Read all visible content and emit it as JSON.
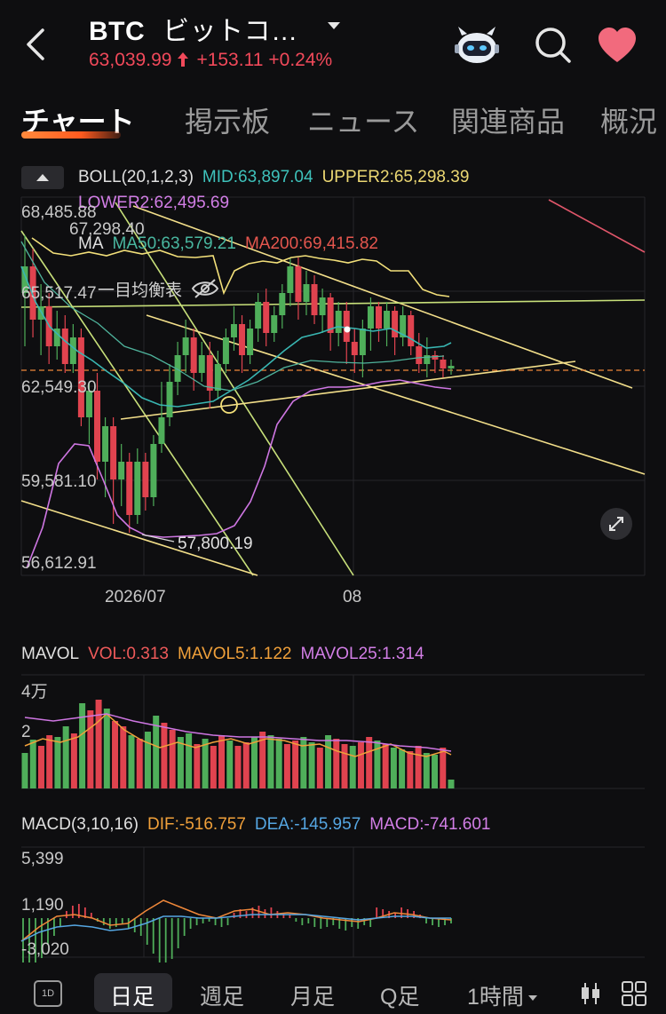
{
  "header": {
    "symbol": "BTC",
    "name": "ビットコ…",
    "price": "63,039.99",
    "change": "+153.11",
    "change_pct": "+0.24%",
    "up_color": "#f1495a",
    "icons": [
      "back-icon",
      "chevron-down-icon",
      "robot-icon",
      "search-icon",
      "heart-icon"
    ]
  },
  "tabs": [
    {
      "label": "チャート",
      "active": true
    },
    {
      "label": "掲示板"
    },
    {
      "label": "ニュース"
    },
    {
      "label": "関連商品"
    },
    {
      "label": "概況"
    }
  ],
  "main_chart": {
    "boll": {
      "label": "BOLL(20,1,2,3)",
      "mid": "MID:63,897.04",
      "upper2": "UPPER2:65,298.39",
      "lower2": "LOWER2:62,495.69"
    },
    "ma": {
      "label": "MA",
      "ma50": "MA50:63,579.21",
      "ma200": "MA200:69,415.82"
    },
    "ichimoku_label": "一目均衡表",
    "y_labels": [
      "68,485.88",
      "67,298.40",
      "65,517.47",
      "62,549.30",
      "59,581.10",
      "56,612.91"
    ],
    "low_marker": "57,800.19",
    "x_labels": [
      "2026/07",
      "08"
    ]
  },
  "volume_panel": {
    "label": "MAVOL",
    "vol": "VOL:0.313",
    "mavol5": "MAVOL5:1.122",
    "mavol25": "MAVOL25:1.314",
    "y_labels": [
      "4万",
      "2"
    ]
  },
  "macd_panel": {
    "label": "MACD(3,10,16)",
    "dif": "DIF:-516.757",
    "dea": "DEA:-145.957",
    "macd": "MACD:-741.601",
    "y_labels": [
      "5,399",
      "1,190",
      "-3,020"
    ]
  },
  "bottom_bar": {
    "icon_1d": "1D",
    "periods": [
      "日足",
      "週足",
      "月足",
      "Q足",
      "1時間"
    ],
    "active_period": "日足"
  }
}
